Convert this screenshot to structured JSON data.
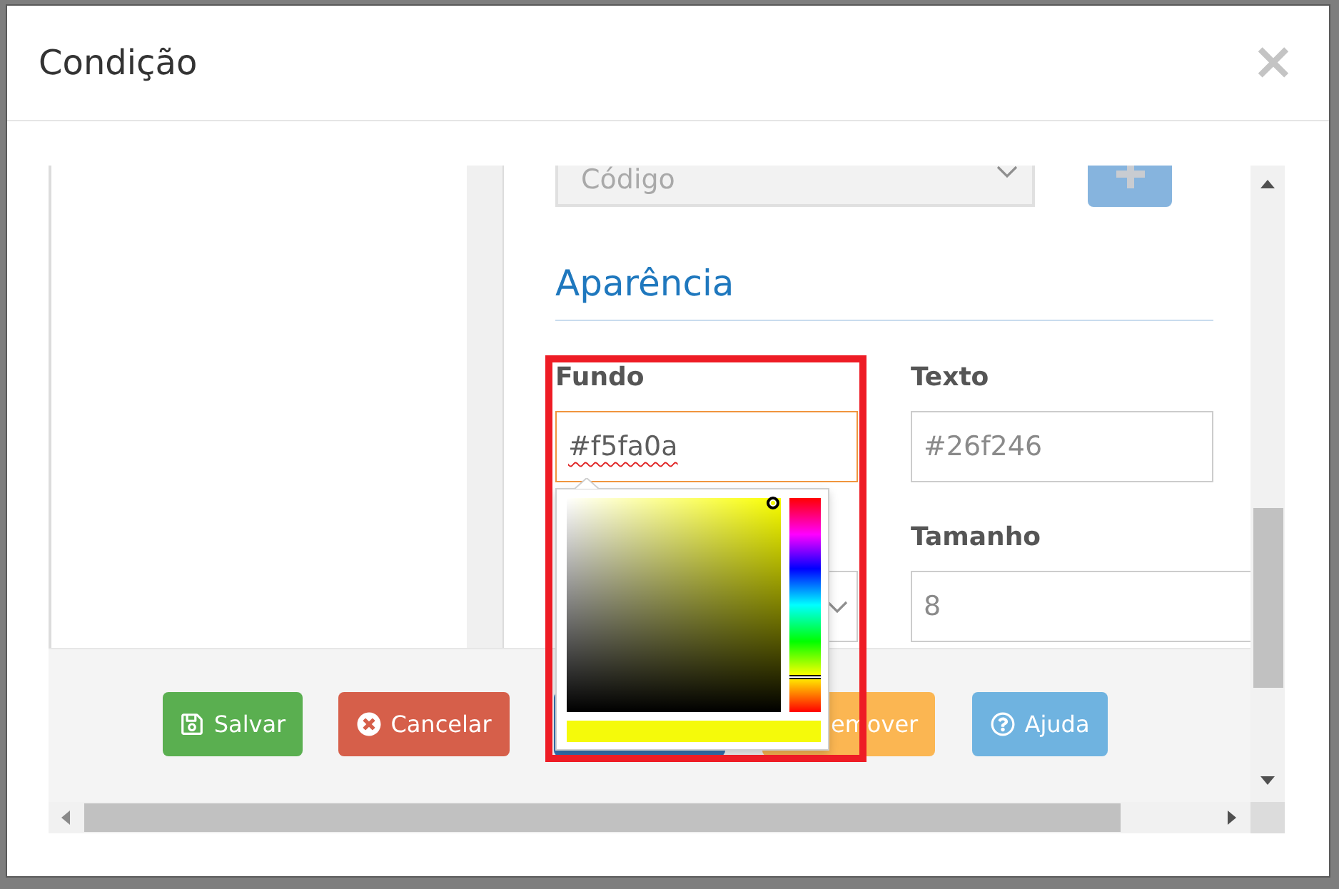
{
  "dialog": {
    "title": "Condição",
    "close_label": "×"
  },
  "code_select": {
    "value": "Código",
    "disabled": true
  },
  "add_button": {
    "disabled": true
  },
  "section": {
    "title": "Aparência"
  },
  "fields": [
    {
      "kind": "color",
      "label": "Fundo",
      "value": "#f5fa0a",
      "focused": true,
      "misspelled": true,
      "highlighted": true,
      "color_picker": {
        "saturation_slider": {
          "level": 0.96
        },
        "brightness_slider": {
          "level": 0.98
        },
        "hue_slider": {
          "level": 0.17
        }
      }
    },
    {
      "kind": "color",
      "label": "Texto",
      "value": "#26f246",
      "focused": false,
      "misspelled": false,
      "highlighted": false
    },
    {
      "kind": "select",
      "focused": false,
      "highlighted": false
    },
    {
      "kind": "number",
      "label": "Tamanho",
      "value": "8",
      "focused": false,
      "misspelled": false,
      "highlighted": false
    }
  ],
  "footer_buttons": [
    {
      "kind": "save",
      "label": "Salvar"
    },
    {
      "kind": "cancel",
      "label": "Cancelar"
    },
    {
      "kind": "primary"
    },
    {
      "kind": "remove",
      "label": "emover"
    },
    {
      "kind": "help",
      "label": "Ajuda"
    }
  ]
}
